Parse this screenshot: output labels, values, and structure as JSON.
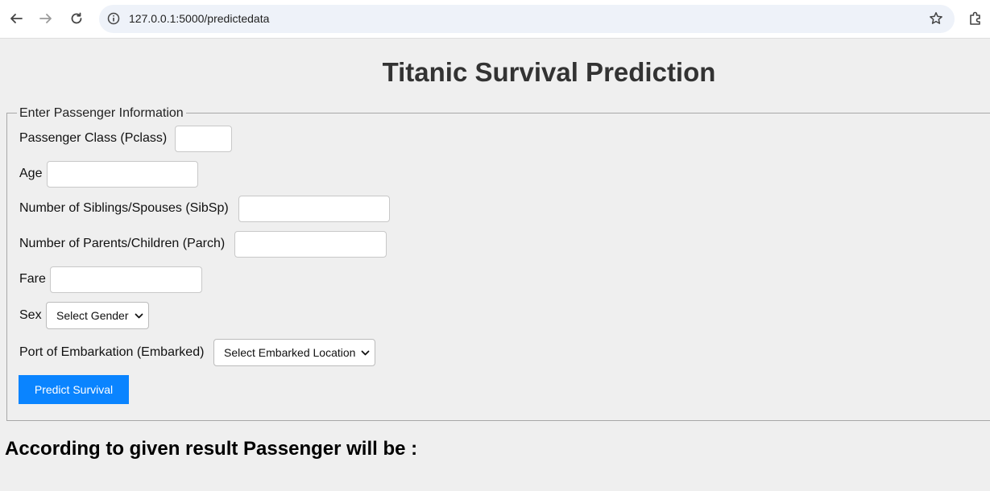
{
  "browser": {
    "url": "127.0.0.1:5000/predictedata"
  },
  "page": {
    "title": "Titanic Survival Prediction",
    "fieldset_legend": "Enter Passenger Information",
    "fields": {
      "pclass": {
        "label": "Passenger Class (Pclass)",
        "value": ""
      },
      "age": {
        "label": "Age",
        "value": ""
      },
      "sibsp": {
        "label": "Number of Siblings/Spouses (SibSp)",
        "value": ""
      },
      "parch": {
        "label": "Number of Parents/Children (Parch)",
        "value": ""
      },
      "fare": {
        "label": "Fare",
        "value": ""
      },
      "sex": {
        "label": "Sex",
        "selected": "Select Gender"
      },
      "embarked": {
        "label": "Port of Embarkation (Embarked)",
        "selected": "Select Embarked Location"
      }
    },
    "submit_label": "Predict Survival",
    "result_text": "According to given result Passenger will be :"
  },
  "colors": {
    "page_bg": "#efefef",
    "title": "#333333",
    "button_bg": "#0a84ff",
    "button_text": "#ffffff"
  },
  "icons": [
    "back-arrow-icon",
    "forward-arrow-icon",
    "reload-icon",
    "site-info-icon",
    "bookmark-star-icon",
    "extensions-icon",
    "chevron-down-icon"
  ]
}
